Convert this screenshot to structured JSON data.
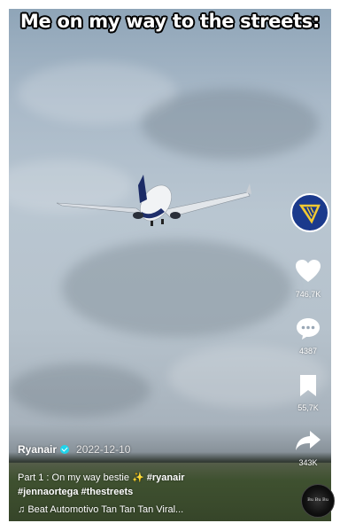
{
  "caption": "Me on my way to the streets:",
  "video": {
    "author": "Ryanair",
    "date": "2022-12-10",
    "description_prefix": "Part 1 : On my way bestie",
    "sparkle": "✨",
    "hashtag_1": "#ryanair",
    "hashtag_2": "#jennaortega",
    "hashtag_3": "#thestreets",
    "music_icon": "♫",
    "music": "Beat Automotivo Tan Tan Tan Viral...",
    "disc_label": "Bu Bu Bu"
  },
  "actions": {
    "likes": "746,7K",
    "comments": "4387",
    "saves": "55,7K",
    "shares": "343K"
  },
  "colors": {
    "avatar_bg": "#1b3a8c",
    "harp_gold": "#f1c933",
    "verified": "#20d5ec"
  },
  "icons": [
    "ryanair-harp-icon",
    "heart-icon",
    "comment-icon",
    "bookmark-icon",
    "share-icon",
    "music-note-icon",
    "verified-badge-icon"
  ]
}
